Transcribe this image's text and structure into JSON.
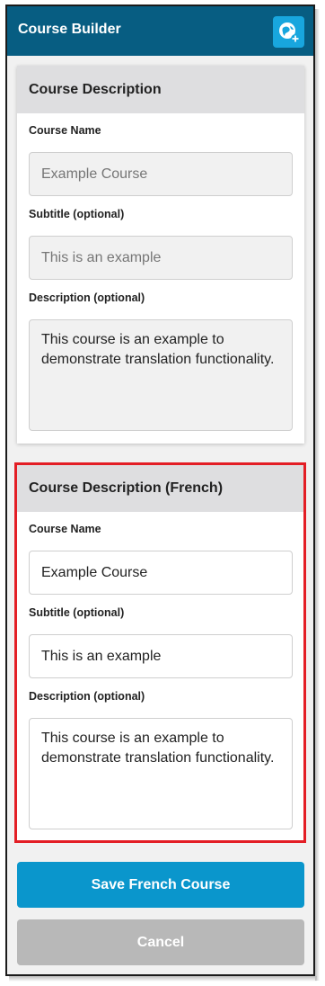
{
  "header": {
    "title": "Course Builder",
    "globe_icon": "globe-add-icon"
  },
  "panel_default": {
    "title": "Course Description",
    "course_name_label": "Course Name",
    "course_name_value": "Example Course",
    "subtitle_label": "Subtitle (optional)",
    "subtitle_value": "This is an example",
    "description_label": "Description (optional)",
    "description_value": "This course is an example to demonstrate translation functionality."
  },
  "panel_french": {
    "title": "Course Description (French)",
    "course_name_label": "Course Name",
    "course_name_value": "Example Course",
    "subtitle_label": "Subtitle (optional)",
    "subtitle_value": "This is an example",
    "description_label": "Description (optional)",
    "description_value": "This course is an example to demonstrate translation functionality."
  },
  "buttons": {
    "save_label": "Save French Course",
    "cancel_label": "Cancel"
  },
  "colors": {
    "header": "#075d82",
    "accent": "#0a96cc",
    "highlight": "#e31e25",
    "cancel": "#b8b8b8"
  }
}
